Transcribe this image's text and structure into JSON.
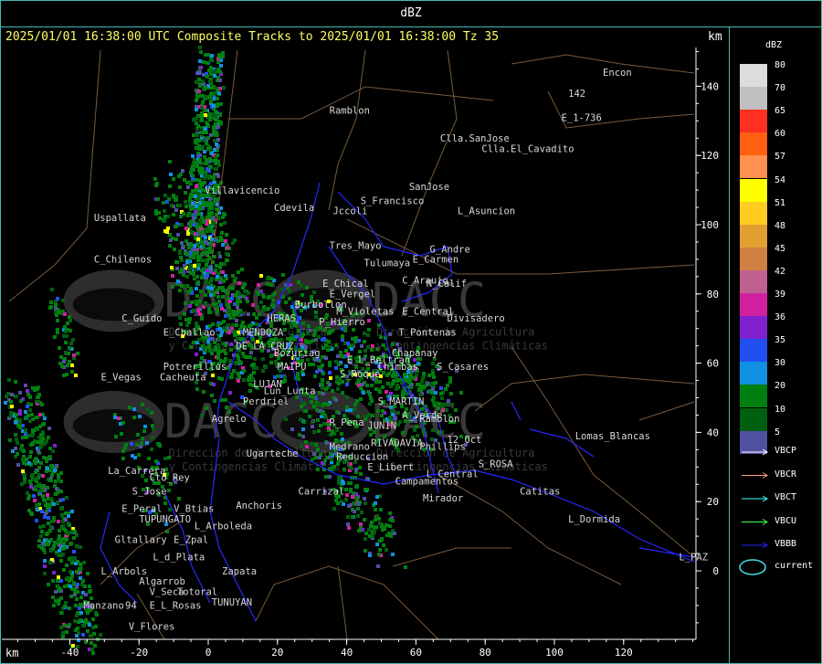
{
  "window_title": "dBZ",
  "header": "2025/01/01 16:38:00 UTC Composite Tracks to 2025/01/01 16:38:00 Tz 35",
  "axis_unit_top": "km",
  "axis_unit_bottom": "km",
  "x_ticks": [
    "-40",
    "-20",
    "0",
    "20",
    "40",
    "60",
    "80",
    "100",
    "120"
  ],
  "y_ticks": [
    "140",
    "120",
    "100",
    "80",
    "60",
    "40",
    "20",
    "0"
  ],
  "legend": {
    "title": "dBZ",
    "levels": [
      {
        "label": "80",
        "color": "#dcdcdc"
      },
      {
        "label": "70",
        "color": "#c0c0c0"
      },
      {
        "label": "65",
        "color": "#ff3020"
      },
      {
        "label": "60",
        "color": "#ff6010"
      },
      {
        "label": "57",
        "color": "#ff9050"
      },
      {
        "label": "54",
        "color": "#ffff00"
      },
      {
        "label": "51",
        "color": "#ffcc20"
      },
      {
        "label": "48",
        "color": "#e0a030"
      },
      {
        "label": "45",
        "color": "#d08040"
      },
      {
        "label": "42",
        "color": "#c06090"
      },
      {
        "label": "39",
        "color": "#d020a0"
      },
      {
        "label": "36",
        "color": "#8020d0"
      },
      {
        "label": "35",
        "color": "#2050f0"
      },
      {
        "label": "30",
        "color": "#1090e0"
      },
      {
        "label": "20",
        "color": "#008010"
      },
      {
        "label": "10",
        "color": "#006010"
      },
      {
        "label": "5",
        "color": "#5050a0"
      }
    ],
    "tracks": [
      {
        "label": "VBCP",
        "color": "#ffffff"
      },
      {
        "label": "VBCR",
        "color": "#ffa080"
      },
      {
        "label": "VBCT",
        "color": "#40ffff"
      },
      {
        "label": "VBCU",
        "color": "#40ff40"
      },
      {
        "label": "VBBB",
        "color": "#2020ff"
      }
    ],
    "current_label": "current",
    "current_color": "#40e0f0"
  },
  "watermark": {
    "org": "DACC",
    "line1": "Dirección de Agricultura",
    "line2": "y Contingencias Climáticas"
  },
  "places": [
    {
      "name": "Encon",
      "x": 114,
      "y": 143
    },
    {
      "name": "142",
      "x": 104,
      "y": 137
    },
    {
      "name": "E_1-736",
      "x": 102,
      "y": 130
    },
    {
      "name": "Ramblon",
      "x": 35,
      "y": 132
    },
    {
      "name": "Clla.SanJose",
      "x": 67,
      "y": 124
    },
    {
      "name": "Clla.El_Cavadito",
      "x": 79,
      "y": 121
    },
    {
      "name": "SanJose",
      "x": 58,
      "y": 110
    },
    {
      "name": "S_Francisco",
      "x": 44,
      "y": 106
    },
    {
      "name": "Jccoli",
      "x": 36,
      "y": 103
    },
    {
      "name": "L_Asuncion",
      "x": 72,
      "y": 103
    },
    {
      "name": "Uspallata",
      "x": -33,
      "y": 101
    },
    {
      "name": "Villavicencio",
      "x": -1,
      "y": 109
    },
    {
      "name": "Cdevila",
      "x": 19,
      "y": 104
    },
    {
      "name": "Tres_Mayo",
      "x": 35,
      "y": 93
    },
    {
      "name": "G_Andre",
      "x": 64,
      "y": 92
    },
    {
      "name": "Tulumaya",
      "x": 45,
      "y": 88
    },
    {
      "name": "E_Carmen",
      "x": 59,
      "y": 89
    },
    {
      "name": "C_Chilenos",
      "x": -33,
      "y": 89
    },
    {
      "name": "C_Araujo",
      "x": 56,
      "y": 83
    },
    {
      "name": "N_Calif",
      "x": 63,
      "y": 82
    },
    {
      "name": "E_Chical",
      "x": 33,
      "y": 82
    },
    {
      "name": "E_Vergel",
      "x": 35,
      "y": 79
    },
    {
      "name": "Burbollon",
      "x": 25,
      "y": 76
    },
    {
      "name": "E_Central",
      "x": 56,
      "y": 74
    },
    {
      "name": "Divisadero",
      "x": 69,
      "y": 72
    },
    {
      "name": "C_Guido",
      "x": -25,
      "y": 72
    },
    {
      "name": "M_Violetas",
      "x": 37,
      "y": 74
    },
    {
      "name": "P_Hierro",
      "x": 32,
      "y": 71
    },
    {
      "name": "HERAS",
      "x": 17,
      "y": 72
    },
    {
      "name": "MENDOZA",
      "x": 10,
      "y": 68
    },
    {
      "name": "E_Challao",
      "x": -13,
      "y": 68
    },
    {
      "name": "T_Pontenas",
      "x": 55,
      "y": 68
    },
    {
      "name": "DE LA CRUZ",
      "x": 8,
      "y": 64
    },
    {
      "name": "Bozuriag",
      "x": 19,
      "y": 62
    },
    {
      "name": "Chapanay",
      "x": 53,
      "y": 62
    },
    {
      "name": "E_L_Beltran",
      "x": 40,
      "y": 60
    },
    {
      "name": "MAIPU",
      "x": 20,
      "y": 58
    },
    {
      "name": "Chimbas",
      "x": 49,
      "y": 58
    },
    {
      "name": "S_Casares",
      "x": 66,
      "y": 58
    },
    {
      "name": "Potrerillos",
      "x": -13,
      "y": 58
    },
    {
      "name": "Cacheuta",
      "x": -14,
      "y": 55
    },
    {
      "name": "E_Vegas",
      "x": -31,
      "y": 55
    },
    {
      "name": "S_Roque",
      "x": 38,
      "y": 56
    },
    {
      "name": "LUJAN",
      "x": 13,
      "y": 53
    },
    {
      "name": "Lun_Lunta",
      "x": 16,
      "y": 51
    },
    {
      "name": "S_MARTIN",
      "x": 49,
      "y": 48
    },
    {
      "name": "Perdriel",
      "x": 10,
      "y": 48
    },
    {
      "name": "Agrelo",
      "x": 1,
      "y": 43
    },
    {
      "name": "A_Verde",
      "x": 56,
      "y": 44
    },
    {
      "name": "Ramblon",
      "x": 61,
      "y": 43
    },
    {
      "name": "R_Pena",
      "x": 35,
      "y": 42
    },
    {
      "name": "JUNIN",
      "x": 46,
      "y": 41
    },
    {
      "name": "RIVADAVIA",
      "x": 47,
      "y": 36
    },
    {
      "name": "Phillips",
      "x": 61,
      "y": 35
    },
    {
      "name": "12_Oct",
      "x": 69,
      "y": 37
    },
    {
      "name": "Lomas_Blancas",
      "x": 106,
      "y": 38
    },
    {
      "name": "Medrano",
      "x": 35,
      "y": 35
    },
    {
      "name": "Reduccion",
      "x": 37,
      "y": 32
    },
    {
      "name": "E_Libert",
      "x": 46,
      "y": 29
    },
    {
      "name": "S_ROSA",
      "x": 78,
      "y": 30
    },
    {
      "name": "Ugarteche",
      "x": 11,
      "y": 33
    },
    {
      "name": "La_Carrera",
      "x": -29,
      "y": 28
    },
    {
      "name": "Cto_Rey",
      "x": -17,
      "y": 26
    },
    {
      "name": "L_Central",
      "x": 63,
      "y": 27
    },
    {
      "name": "Campamentos",
      "x": 54,
      "y": 25
    },
    {
      "name": "S_Jose",
      "x": -22,
      "y": 22
    },
    {
      "name": "Carrizal",
      "x": 26,
      "y": 22
    },
    {
      "name": "Catitas",
      "x": 90,
      "y": 22
    },
    {
      "name": "Mirador",
      "x": 62,
      "y": 20
    },
    {
      "name": "Anchoris",
      "x": 8,
      "y": 18
    },
    {
      "name": "E_Peral",
      "x": -25,
      "y": 17
    },
    {
      "name": "V_Btias",
      "x": -10,
      "y": 17
    },
    {
      "name": "TUPUNGATO",
      "x": -20,
      "y": 14
    },
    {
      "name": "L_Dormida",
      "x": 104,
      "y": 14
    },
    {
      "name": "L_Arboleda",
      "x": -4,
      "y": 12
    },
    {
      "name": "Gltallary",
      "x": -27,
      "y": 8
    },
    {
      "name": "E_Zpal",
      "x": -10,
      "y": 8
    },
    {
      "name": "L_d_Plata",
      "x": -16,
      "y": 3
    },
    {
      "name": "L_PAZ",
      "x": 136,
      "y": 3
    },
    {
      "name": "L_Arbols",
      "x": -31,
      "y": -1
    },
    {
      "name": "Zapata",
      "x": 4,
      "y": -1
    },
    {
      "name": "Algarrob",
      "x": -20,
      "y": -4
    },
    {
      "name": "Totoral",
      "x": -9,
      "y": -7
    },
    {
      "name": "V_Seca",
      "x": -17,
      "y": -7
    },
    {
      "name": "TUNUYAN",
      "x": 1,
      "y": -10
    },
    {
      "name": "Manzano",
      "x": -36,
      "y": -11
    },
    {
      "name": "E_L_Rosas",
      "x": -17,
      "y": -11
    },
    {
      "name": "V_Flores",
      "x": -23,
      "y": -17
    },
    {
      "name": "94",
      "x": -24,
      "y": -11
    }
  ]
}
